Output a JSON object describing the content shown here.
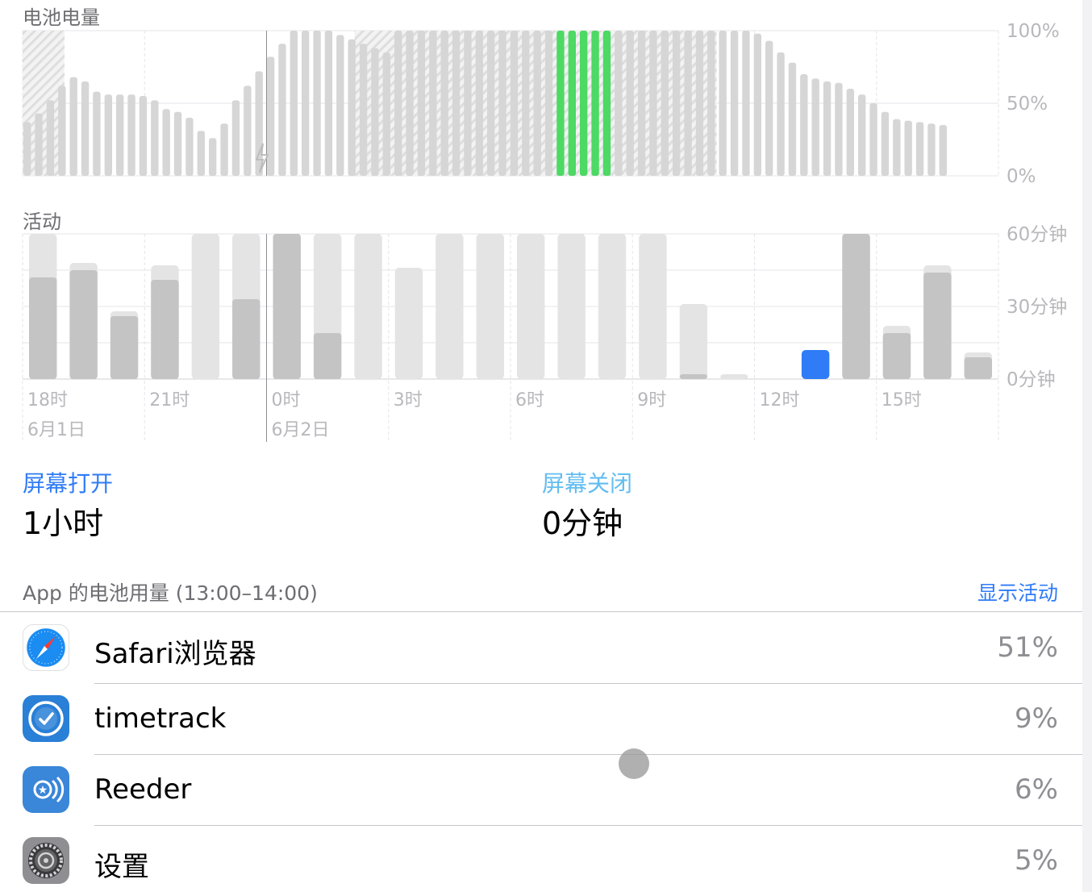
{
  "battery_section": {
    "title": "电池电量"
  },
  "activity_section": {
    "title": "活动"
  },
  "chart_data": [
    {
      "type": "bar",
      "title": "电池电量",
      "y_ticks": [
        "100%",
        "50%",
        "0%"
      ],
      "ylim": [
        0,
        100
      ],
      "unit": "%",
      "charging_from_index": 15,
      "charging_to_index": 38,
      "charging_icon": "lightning-bolt-icon",
      "highlight_indices": [
        46,
        47,
        48,
        49,
        50
      ],
      "values": [
        37,
        43,
        52,
        62,
        68,
        65,
        58,
        56,
        56,
        56,
        55,
        52,
        46,
        44,
        40,
        31,
        26,
        36,
        52,
        62,
        72,
        82,
        91,
        100,
        100,
        100,
        100,
        97,
        94,
        91,
        88,
        85,
        100,
        100,
        100,
        100,
        100,
        100,
        100,
        100,
        100,
        100,
        100,
        100,
        100,
        100,
        100,
        100,
        100,
        100,
        100,
        100,
        100,
        100,
        100,
        100,
        100,
        100,
        100,
        100,
        100,
        100,
        100,
        98,
        93,
        85,
        78,
        70,
        67,
        65,
        64,
        60,
        56,
        50,
        44,
        39,
        38,
        37,
        36,
        35
      ]
    },
    {
      "type": "bar",
      "title": "活动",
      "y_ticks": [
        "60分钟",
        "30分钟",
        "0分钟"
      ],
      "ylim": [
        0,
        60
      ],
      "unit": "分钟",
      "x_tick_labels": [
        "18时",
        "21时",
        "0时",
        "3时",
        "6时",
        "9时",
        "12时",
        "15时"
      ],
      "date_labels": [
        "6月1日",
        "6月2日"
      ],
      "highlight_index": 19,
      "series": [
        {
          "name": "屏幕打开",
          "values": [
            42,
            45,
            26,
            41,
            0,
            33,
            60,
            19,
            0,
            0,
            0,
            0,
            0,
            0,
            0,
            0,
            2,
            0,
            0,
            12,
            60,
            19,
            44,
            9
          ]
        },
        {
          "name": "屏幕关闭",
          "values": [
            18,
            3,
            2,
            6,
            60,
            27,
            0,
            41,
            60,
            46,
            60,
            60,
            60,
            60,
            60,
            60,
            29,
            2,
            0,
            0,
            0,
            3,
            3,
            2
          ]
        }
      ]
    }
  ],
  "summary": {
    "screen_on_label": "屏幕打开",
    "screen_on_value": "1小时",
    "screen_off_label": "屏幕关闭",
    "screen_off_value": "0分钟"
  },
  "usage": {
    "header": "App 的电池用量 (13:00–14:00)",
    "toggle_label": "显示活动",
    "apps": [
      {
        "name": "Safari浏览器",
        "percent": "51%",
        "icon": "safari-compass-icon"
      },
      {
        "name": "timetrack",
        "percent": "9%",
        "icon": "timetrack-clock-icon"
      },
      {
        "name": "Reeder",
        "percent": "6%",
        "icon": "reeder-star-icon"
      },
      {
        "name": "设置",
        "percent": "5%",
        "icon": "settings-gear-icon"
      }
    ]
  },
  "colors": {
    "accent_blue": "#2f7cf6",
    "screen_off_blue": "#62bdf0",
    "battery_green": "#4cd964",
    "bar_gray": "#d6d6d6",
    "bar_light": "#e4e4e4",
    "bar_dark": "#c4c4c4",
    "label_gray": "#b8b8bc"
  }
}
